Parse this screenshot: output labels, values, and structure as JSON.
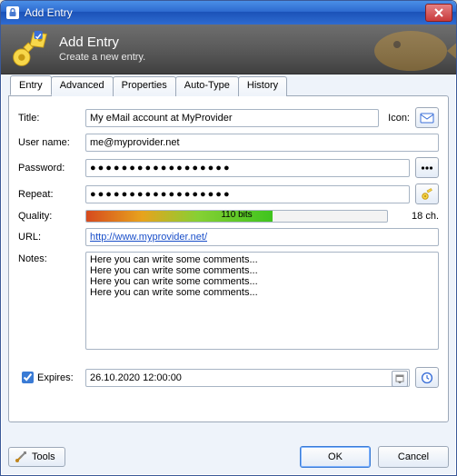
{
  "window": {
    "title": "Add Entry"
  },
  "header": {
    "title": "Add Entry",
    "subtitle": "Create a new entry."
  },
  "tabs": [
    "Entry",
    "Advanced",
    "Properties",
    "Auto-Type",
    "History"
  ],
  "labels": {
    "title": "Title:",
    "icon": "Icon:",
    "username": "User name:",
    "password": "Password:",
    "repeat": "Repeat:",
    "quality": "Quality:",
    "url": "URL:",
    "notes": "Notes:",
    "expires": "Expires:"
  },
  "values": {
    "title": "My eMail account at MyProvider",
    "username": "me@myprovider.net",
    "password_mask": "●●●●●●●●●●●●●●●●●●",
    "repeat_mask": "●●●●●●●●●●●●●●●●●●",
    "quality_bits": "110 bits",
    "char_count": "18 ch.",
    "url": "http://www.myprovider.net/",
    "notes": "Here you can write some comments...\nHere you can write some comments...\nHere you can write some comments...\nHere you can write some comments...",
    "expires": "26.10.2020 12:00:00",
    "expires_checked": true
  },
  "buttons": {
    "tools": "Tools",
    "ok": "OK",
    "cancel": "Cancel"
  }
}
